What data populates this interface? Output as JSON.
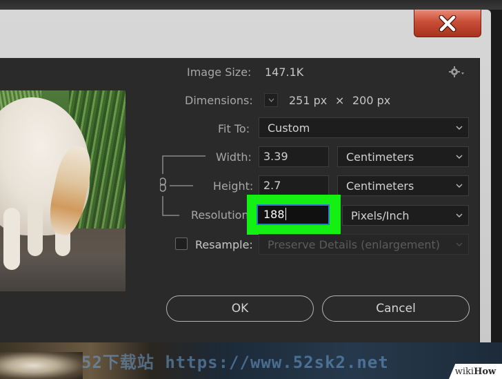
{
  "dialog": {
    "image_size_label": "Image Size:",
    "image_size_value": "147.1K",
    "dimensions_label": "Dimensions:",
    "dimensions_w": "251 px",
    "dimensions_x": "×",
    "dimensions_h": "200 px",
    "fit_to_label": "Fit To:",
    "fit_to_value": "Custom",
    "width_label": "Width:",
    "width_value": "3.39",
    "width_unit": "Centimeters",
    "height_label": "Height:",
    "height_value": "2.7",
    "height_unit": "Centimeters",
    "resolution_label": "Resolution:",
    "resolution_value": "188",
    "resolution_unit": "Pixels/Inch",
    "resample_label": "Resample:",
    "resample_value": "Preserve Details (enlargement)",
    "resample_checked": false,
    "ok_label": "OK",
    "cancel_label": "Cancel"
  },
  "watermark": "52下载站 https://www.52sk2.net",
  "brand": {
    "wiki": "wiki",
    "how": "How"
  },
  "colors": {
    "highlight": "#14f014",
    "close_button": "#c84e37",
    "dialog_bg": "#2a2a2a",
    "focus_border": "#2f76c8"
  },
  "icons": [
    "close-icon",
    "gear-icon",
    "chevron-down-icon",
    "link-icon"
  ]
}
